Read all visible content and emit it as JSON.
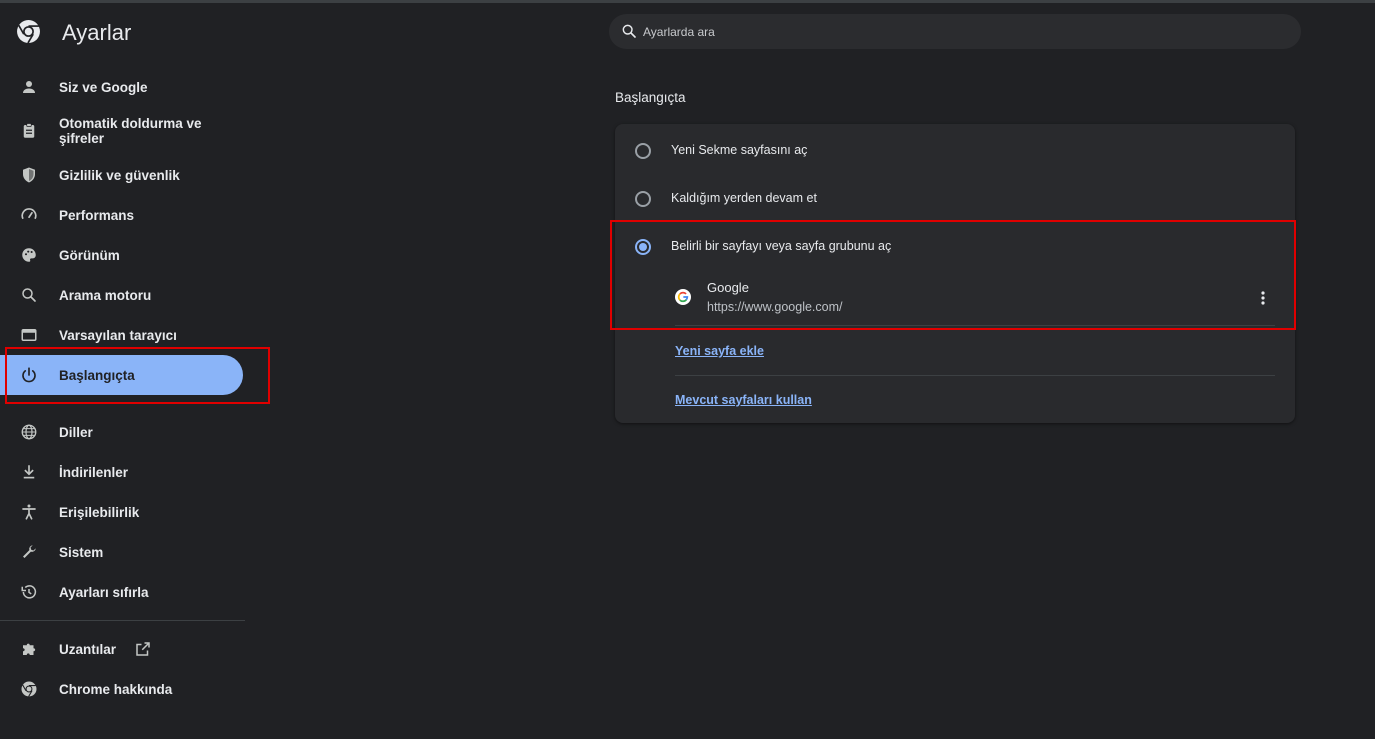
{
  "app": {
    "title": "Ayarlar"
  },
  "search": {
    "placeholder": "Ayarlarda ara"
  },
  "sidebar": {
    "items": [
      {
        "label": "Siz ve Google",
        "icon": "person-icon"
      },
      {
        "label": "Otomatik doldurma ve şifreler",
        "icon": "clipboard-icon"
      },
      {
        "label": "Gizlilik ve güvenlik",
        "icon": "shield-icon"
      },
      {
        "label": "Performans",
        "icon": "speedometer-icon"
      },
      {
        "label": "Görünüm",
        "icon": "palette-icon"
      },
      {
        "label": "Arama motoru",
        "icon": "search-icon"
      },
      {
        "label": "Varsayılan tarayıcı",
        "icon": "browser-window-icon"
      },
      {
        "label": "Başlangıçta",
        "icon": "power-icon",
        "active": true
      },
      {
        "label": "Diller",
        "icon": "globe-icon"
      },
      {
        "label": "İndirilenler",
        "icon": "download-icon"
      },
      {
        "label": "Erişilebilirlik",
        "icon": "accessibility-icon"
      },
      {
        "label": "Sistem",
        "icon": "wrench-icon"
      },
      {
        "label": "Ayarları sıfırla",
        "icon": "history-icon"
      },
      {
        "label": "Uzantılar",
        "icon": "puzzle-icon"
      },
      {
        "label": "Chrome hakkında",
        "icon": "chrome-icon"
      }
    ]
  },
  "main": {
    "section_title": "Başlangıçta",
    "options": [
      {
        "label": "Yeni Sekme sayfasını aç",
        "selected": false
      },
      {
        "label": "Kaldığım yerden devam et",
        "selected": false
      },
      {
        "label": "Belirli bir sayfayı veya sayfa grubunu aç",
        "selected": true
      }
    ],
    "page": {
      "name": "Google",
      "url": "https://www.google.com/"
    },
    "add_page_link": "Yeni sayfa ekle",
    "use_current_link": "Mevcut sayfaları kullan"
  },
  "colors": {
    "background": "#202124",
    "card": "#292a2d",
    "accent": "#8ab4f8",
    "highlight": "#e00000"
  }
}
